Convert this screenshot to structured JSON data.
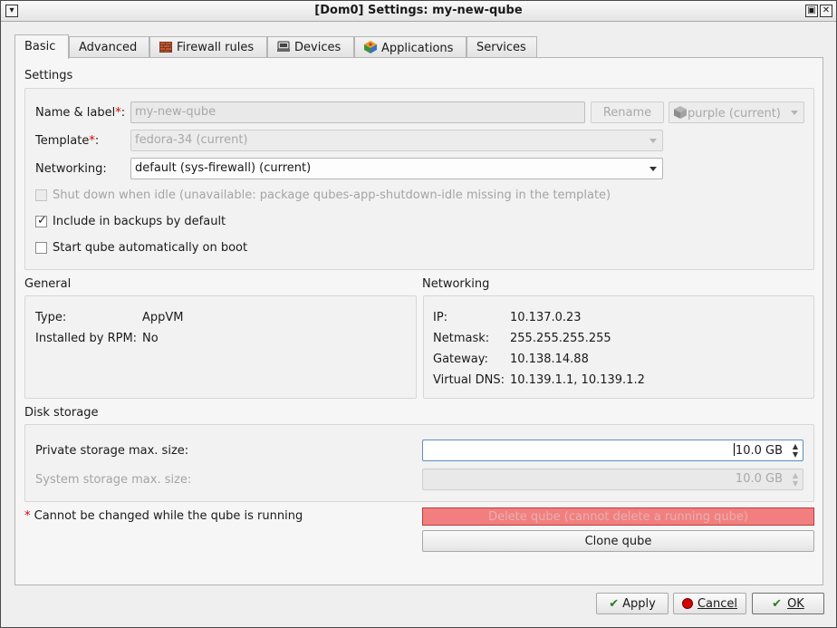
{
  "window": {
    "title": "[Dom0] Settings: my-new-qube",
    "menu_glyph": "▾",
    "maximize_glyph": "▣",
    "close_glyph": "✕"
  },
  "tabs": [
    {
      "label": "Basic",
      "icon": ""
    },
    {
      "label": "Advanced",
      "icon": ""
    },
    {
      "label": "Firewall rules",
      "icon": "firewall-icon"
    },
    {
      "label": "Devices",
      "icon": "devices-icon"
    },
    {
      "label": "Applications",
      "icon": "applications-icon"
    },
    {
      "label": "Services",
      "icon": ""
    }
  ],
  "settings": {
    "title": "Settings",
    "name_label": "Name & label",
    "required_mark": "*",
    "label_suffix": ":",
    "name_value": "my-new-qube",
    "rename_label": "Rename",
    "color_label": "purple (current)",
    "template_label": "Template",
    "template_value": "fedora-34 (current)",
    "networking_label": "Networking:",
    "networking_value": "default (sys-firewall) (current)",
    "shutdown_idle_label": "Shut down when idle (unavailable: package qubes-app-shutdown-idle missing in the template)",
    "backups_label": "Include in backups by default",
    "backups_checked": true,
    "autostart_label": "Start qube automatically on boot",
    "autostart_checked": false,
    "check_glyph": "✓"
  },
  "general": {
    "title": "General",
    "type_label": "Type:",
    "type_value": "AppVM",
    "rpm_label": "Installed by RPM:",
    "rpm_value": "No"
  },
  "networking": {
    "title": "Networking",
    "ip_label": "IP:",
    "ip_value": "10.137.0.23",
    "netmask_label": "Netmask:",
    "netmask_value": "255.255.255.255",
    "gateway_label": "Gateway:",
    "gateway_value": "10.138.14.88",
    "dns_label": "Virtual DNS:",
    "dns_value": "10.139.1.1, 10.139.1.2"
  },
  "disk": {
    "title": "Disk storage",
    "private_label": "Private storage max. size:",
    "private_value": "10.0 GB",
    "system_label": "System storage max. size:",
    "system_value": "10.0 GB"
  },
  "footer_note": "Cannot be changed while the qube is running",
  "delete_label": "Delete qube (cannot delete a running qube)",
  "clone_label": "Clone qube",
  "buttons": {
    "apply": "Apply",
    "cancel": "Cancel",
    "ok": "OK"
  },
  "colors": {
    "purple_label": "#8a8a8a",
    "delete_bg": "#f27f7f",
    "cancel_icon": "#d40000",
    "focus_border": "#5a8ec4"
  }
}
